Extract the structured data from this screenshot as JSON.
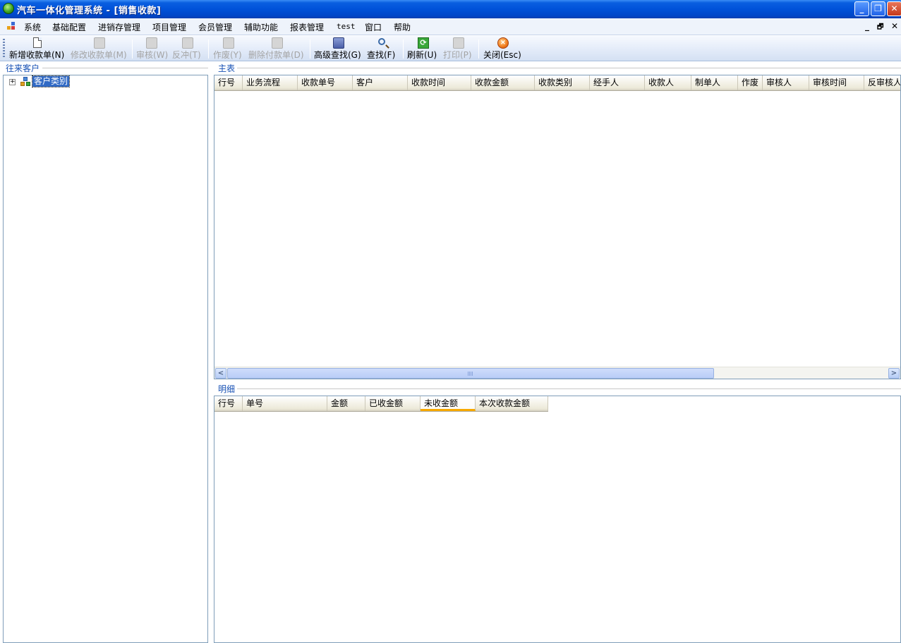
{
  "window": {
    "title": "汽车一体化管理系统 - [销售收款]",
    "minimize": "_",
    "restore": "❐",
    "close": "✕"
  },
  "menu": {
    "items": [
      "系统",
      "基础配置",
      "进销存管理",
      "项目管理",
      "会员管理",
      "辅助功能",
      "报表管理",
      "test",
      "窗口",
      "帮助"
    ],
    "mdi_minimize": "_",
    "mdi_restore": "🗗",
    "mdi_close": "✕"
  },
  "toolbar": {
    "buttons": [
      {
        "label": "新增收款单(N)",
        "icon": "new-document-icon",
        "enabled": true
      },
      {
        "label": "修改收款单(M)",
        "icon": "edit-document-icon",
        "enabled": false
      },
      {
        "label": "审核(W)",
        "icon": "approve-icon",
        "enabled": false
      },
      {
        "label": "反冲(T)",
        "icon": "reverse-icon",
        "enabled": false
      },
      {
        "label": "作废(Y)",
        "icon": "void-icon",
        "enabled": false
      },
      {
        "label": "删除付款单(D)",
        "icon": "delete-icon",
        "enabled": false
      },
      {
        "label": "高级查找(G)",
        "icon": "advanced-search-icon",
        "enabled": true
      },
      {
        "label": "查找(F)",
        "icon": "search-icon",
        "enabled": true
      },
      {
        "label": "刷新(U)",
        "icon": "refresh-icon",
        "enabled": true
      },
      {
        "label": "打印(P)",
        "icon": "print-icon",
        "enabled": false
      },
      {
        "label": "关闭(Esc)",
        "icon": "close-icon",
        "enabled": true
      }
    ]
  },
  "left_panel": {
    "title": "往来客户",
    "tree": [
      {
        "label": "客户类别",
        "expander": "+",
        "selected": true
      }
    ]
  },
  "main_table": {
    "title": "主表",
    "columns": [
      "行号",
      "业务流程",
      "收款单号",
      "客户",
      "收款时间",
      "收款金额",
      "收款类别",
      "经手人",
      "收款人",
      "制单人",
      "作废",
      "审核人",
      "审核时间",
      "反审核人"
    ],
    "rows": []
  },
  "detail_table": {
    "title": "明细",
    "columns": [
      "行号",
      "单号",
      "金额",
      "已收金额",
      "未收金额",
      "本次收款金额"
    ],
    "active_column": "未收金额",
    "rows": []
  },
  "scrollbar": {
    "left_arrow": "<",
    "right_arrow": ">"
  },
  "colors": {
    "titlebar": "#0052d9",
    "selection": "#316ac5",
    "panel_title": "#1650b4",
    "active_column_marker": "#f8a900"
  }
}
